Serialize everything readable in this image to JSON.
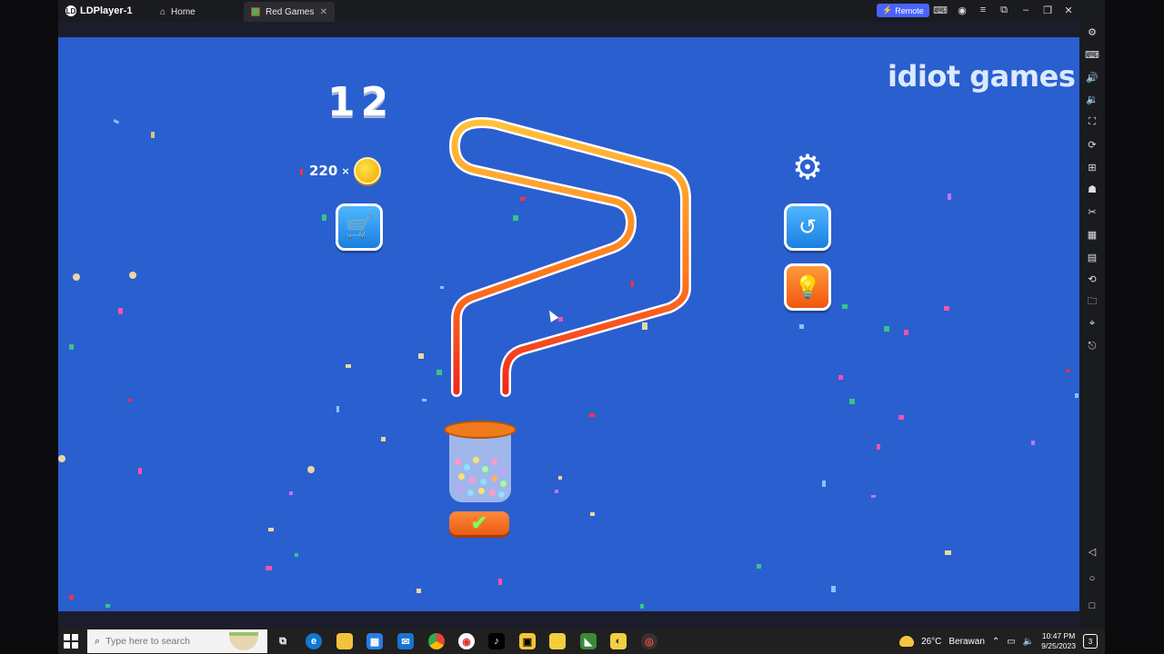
{
  "emulator": {
    "app_name": "LDPlayer-1",
    "tabs": [
      {
        "label": "Home"
      },
      {
        "label": "Red Games"
      }
    ],
    "remote_label": "Remote"
  },
  "game": {
    "level": "12",
    "coins": "220",
    "coin_multiplier": "×",
    "brand": "idiot games",
    "confirm_icon": "checkmark-icon"
  },
  "taskbar": {
    "search_placeholder": "Type here to search",
    "weather_temp": "26°C",
    "weather_text": "Berawan",
    "time": "10:47 PM",
    "date": "9/25/2023",
    "notification_count": "3"
  },
  "colors": {
    "game_bg": "#2a5fd0",
    "pipe_top": "#ffc23a",
    "pipe_bottom": "#f0281e",
    "accent_orange": "#f0560d",
    "accent_blue": "#1a7fe0"
  }
}
